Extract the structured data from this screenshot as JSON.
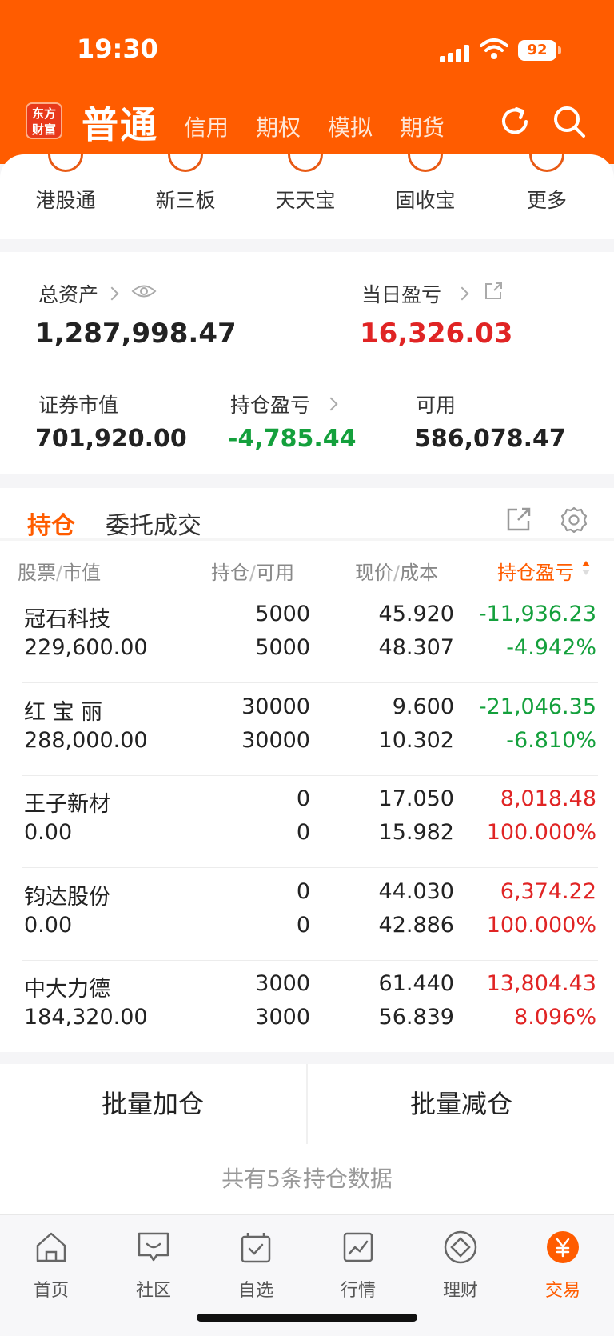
{
  "status": {
    "time": "19:30",
    "battery": "92"
  },
  "header": {
    "logo": "东方财富",
    "title": "普通",
    "tabs": [
      "信用",
      "期权",
      "模拟",
      "期货"
    ]
  },
  "quick_menu": [
    "港股通",
    "新三板",
    "天天宝",
    "固收宝",
    "更多"
  ],
  "assets": {
    "total_label": "总资产",
    "total_value": "1,287,998.47",
    "daily_pl_label": "当日盈亏",
    "daily_pl_value": "16,326.03",
    "market_value_label": "证券市值",
    "market_value": "701,920.00",
    "position_pl_label": "持仓盈亏",
    "position_pl_value": "-4,785.44",
    "available_label": "可用",
    "available_value": "586,078.47"
  },
  "positions": {
    "tab_active": "持仓",
    "tab_other": "委托成交",
    "columns": {
      "c1a": "股票",
      "c1b": "市值",
      "c2a": "持仓",
      "c2b": "可用",
      "c3a": "现价",
      "c3b": "成本",
      "c4": "持仓盈亏"
    },
    "rows": [
      {
        "name": "冠石科技",
        "market_value": "229,600.00",
        "hold": "5000",
        "avail": "5000",
        "price": "45.920",
        "cost": "48.307",
        "pl": "-11,936.23",
        "pl_pct": "-4.942%",
        "dir": "down"
      },
      {
        "name": "红 宝 丽",
        "market_value": "288,000.00",
        "hold": "30000",
        "avail": "30000",
        "price": "9.600",
        "cost": "10.302",
        "pl": "-21,046.35",
        "pl_pct": "-6.810%",
        "dir": "down"
      },
      {
        "name": "王子新材",
        "market_value": "0.00",
        "hold": "0",
        "avail": "0",
        "price": "17.050",
        "cost": "15.982",
        "pl": "8,018.48",
        "pl_pct": "100.000%",
        "dir": "up"
      },
      {
        "name": "钧达股份",
        "market_value": "0.00",
        "hold": "0",
        "avail": "0",
        "price": "44.030",
        "cost": "42.886",
        "pl": "6,374.22",
        "pl_pct": "100.000%",
        "dir": "up"
      },
      {
        "name": "中大力德",
        "market_value": "184,320.00",
        "hold": "3000",
        "avail": "3000",
        "price": "61.440",
        "cost": "56.839",
        "pl": "13,804.43",
        "pl_pct": "8.096%",
        "dir": "up"
      }
    ]
  },
  "batch": {
    "add": "批量加仓",
    "reduce": "批量减仓"
  },
  "summary": "共有5条持仓数据",
  "bottom_nav": [
    "首页",
    "社区",
    "自选",
    "行情",
    "理财",
    "交易"
  ],
  "colors": {
    "brand": "#ff5c00",
    "up": "#e02424",
    "down": "#14a03c"
  }
}
